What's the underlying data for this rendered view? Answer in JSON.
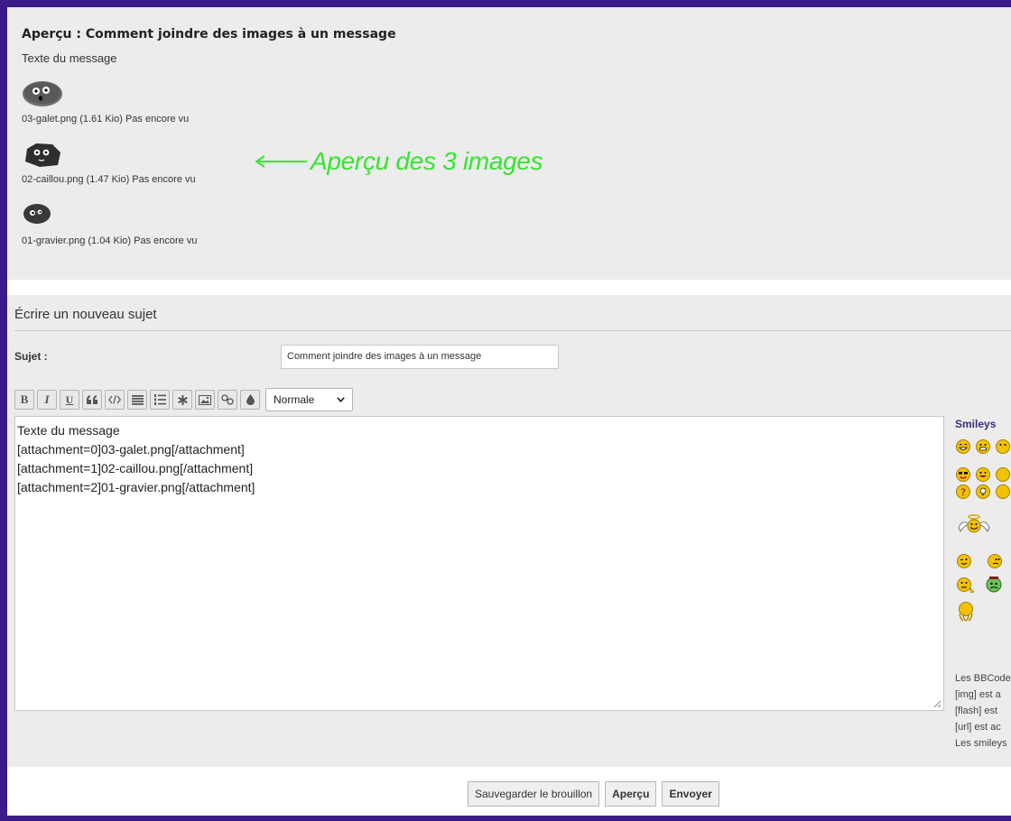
{
  "preview": {
    "title": "Aperçu : Comment joindre des images à un message",
    "body": "Texte du message",
    "attachments": [
      {
        "caption": "03-galet.png (1.61 Kio) Pas encore vu"
      },
      {
        "caption": "02-caillou.png (1.47 Kio) Pas encore vu"
      },
      {
        "caption": "01-gravier.png (1.04 Kio) Pas encore vu"
      }
    ],
    "annotation": "Aperçu des 3 images"
  },
  "editor": {
    "title": "Écrire un nouveau sujet",
    "subject_label": "Sujet :",
    "subject_value": "Comment joindre des images à un message",
    "toolbar": {
      "bold": "B",
      "italic": "I",
      "underline": "U",
      "size_value": "Normale"
    },
    "message_lines": [
      "Texte du message",
      "[attachment=0]03-galet.png[/attachment]",
      "[attachment=1]02-caillou.png[/attachment]",
      "[attachment=2]01-gravier.png[/attachment]"
    ]
  },
  "sidebar": {
    "smileys_title": "Smileys",
    "bbcode_lines": [
      "Les BBCode",
      "[img] est a",
      "[flash] est",
      "[url] est ac",
      "Les smileys"
    ]
  },
  "buttons": {
    "save_draft": "Sauvegarder le brouillon",
    "preview": "Aperçu",
    "submit": "Envoyer"
  },
  "colors": {
    "frame": "#3b1a8a",
    "annotation": "#33e62e",
    "panel": "#ececec",
    "smiley_yellow": "#f2c200"
  }
}
